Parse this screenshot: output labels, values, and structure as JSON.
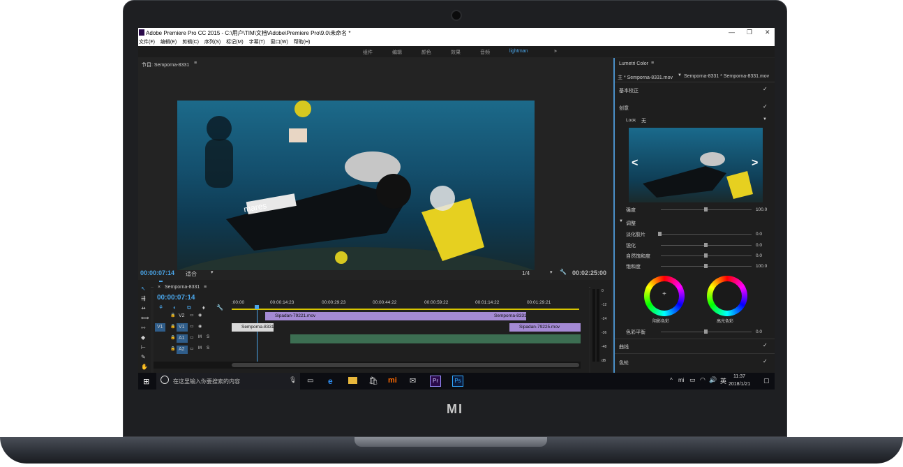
{
  "window": {
    "title": "Adobe Premiere Pro CC 2015 - C:\\用户\\TIM\\文档\\Adobe\\Premiere Pro\\9.0\\未命名 *",
    "controls": [
      "—",
      "❐",
      "✕"
    ]
  },
  "menu": [
    "文件(F)",
    "编辑(E)",
    "剪辑(C)",
    "序列(S)",
    "标记(M)",
    "字幕(T)",
    "窗口(W)",
    "帮助(H)"
  ],
  "workspaces": [
    "组件",
    "编辑",
    "颜色",
    "效果",
    "音频",
    "lightman",
    "»"
  ],
  "program": {
    "header": "节目: Semporna-8331",
    "timecode": "00:00:07:14",
    "fit": "适合",
    "resolution": "1/4",
    "duration": "00:02:25:00",
    "video_text": "mares"
  },
  "timeline": {
    "tab": "Semporna-8331",
    "timecode": "00:00:07:14",
    "ruler": [
      ":00:00",
      "00:00:14:23",
      "00:00:29:23",
      "00:00:44:22",
      "00:00:59:22",
      "00:01:14:22",
      "00:01:29:21"
    ],
    "tracks": [
      "V2",
      "V1",
      "A1",
      "A2"
    ],
    "source_v1": "V1",
    "clips": {
      "v2a": "Sipadan-79221.mov",
      "v2b": "Semporna-8331",
      "v1a": "Semporna-8331",
      "v1b": "Sipadan-79225.mov"
    },
    "meter_ticks": [
      "0",
      "-12",
      "-24",
      "-36",
      "-48",
      "dB"
    ]
  },
  "lumetri": {
    "title": "Lumetri Color",
    "master": "主 * Semporna-8331.mov",
    "clip": "Semporna-8331 * Semporna-8331.mov",
    "basic": "基本校正",
    "creative": "创意",
    "look_label": "Look",
    "look_value": "无",
    "intensity_label": "强度",
    "intensity_value": "100.0",
    "adjust": "调整",
    "faded_label": "淡化胶片",
    "faded_value": "0.0",
    "sharpen_label": "锐化",
    "sharpen_value": "0.0",
    "vibrance_label": "自然饱和度",
    "vibrance_value": "0.0",
    "saturation_label": "饱和度",
    "saturation_value": "100.0",
    "shadow_tint": "阴影色彩",
    "highlight_tint": "高光色彩",
    "tint_balance_label": "色彩平衡",
    "tint_balance_value": "0.0",
    "curves": "曲线",
    "wheels": "色轮"
  },
  "taskbar": {
    "search_placeholder": "在这里输入你要搜索的内容",
    "tray_lang": "英",
    "time": "11:37",
    "date": "2018/1/21"
  },
  "brand": "MI"
}
